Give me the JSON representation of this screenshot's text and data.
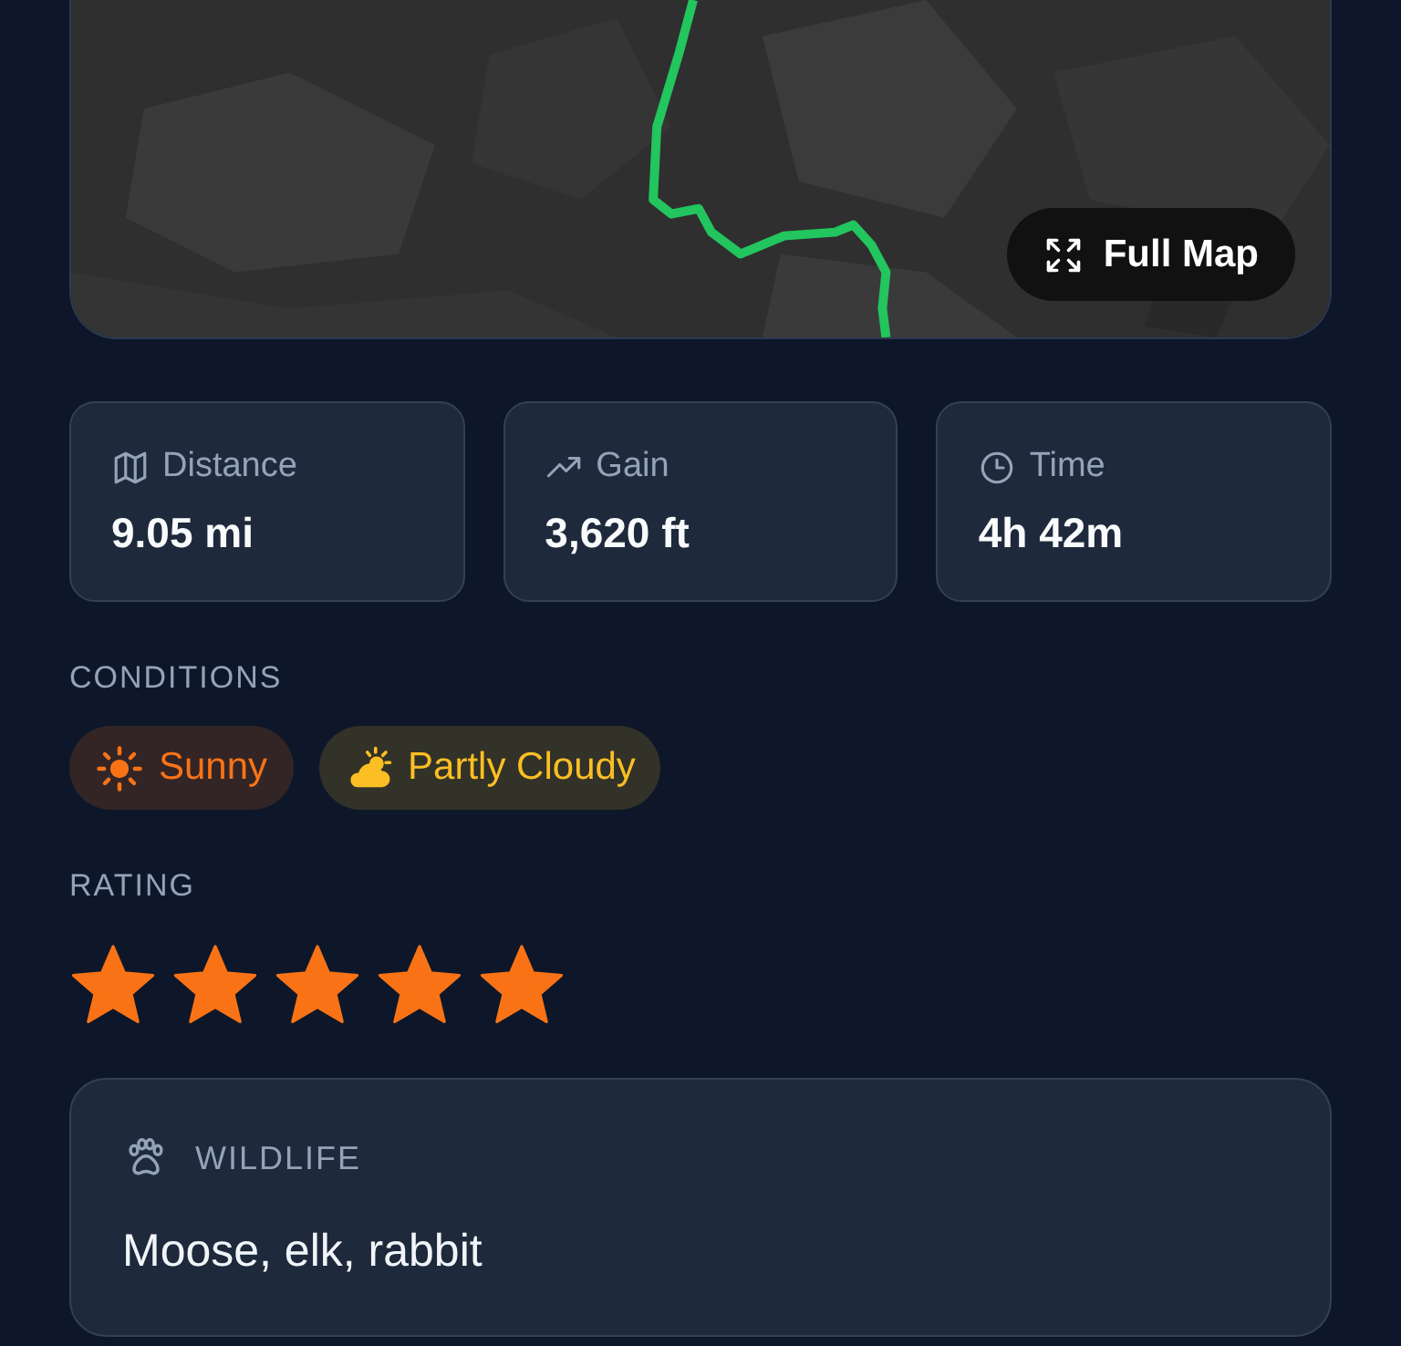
{
  "map": {
    "kind": "picture",
    "button": "Full Map"
  },
  "stats": [
    {
      "kind": "map",
      "label": "Distance",
      "value": "9.05 mi"
    },
    {
      "kind": "trend",
      "label": "Gain",
      "value": "3,620 ft"
    },
    {
      "kind": "clock",
      "label": "Time",
      "value": "4h 42m"
    }
  ],
  "conditions": {
    "heading": "CONDITIONS",
    "items": [
      {
        "kind": "sunny",
        "label": "Sunny",
        "color": "#f97316"
      },
      {
        "kind": "partly_cloudy",
        "label": "Partly Cloudy",
        "color": "#fbbf24"
      }
    ]
  },
  "rating": {
    "heading": "RATING",
    "stars": 5
  },
  "wildlife": {
    "heading": "WILDLIFE",
    "text": "Moose, elk, rabbit"
  }
}
